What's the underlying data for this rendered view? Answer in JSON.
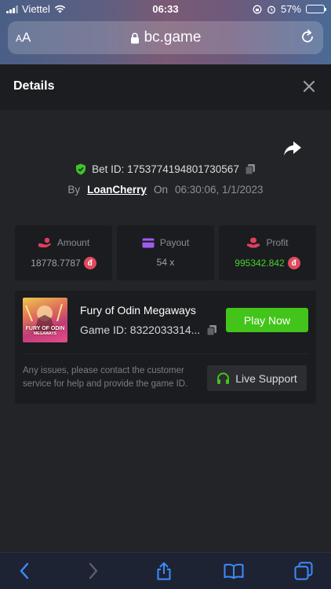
{
  "status_bar": {
    "carrier": "Viettel",
    "time": "06:33",
    "battery": "57%",
    "battery_level": 0.57
  },
  "browser": {
    "text_size_label": "AA",
    "url": "bc.game"
  },
  "modal": {
    "title": "Details"
  },
  "bet": {
    "id_label": "Bet ID: 1753774194801730567",
    "by_label": "By",
    "user": "LoanCherry",
    "on_label": "On",
    "datetime": "06:30:06, 1/1/2023"
  },
  "stats": [
    {
      "label": "Amount",
      "value": "18778.7787",
      "currency_icon": "d-coin-icon"
    },
    {
      "label": "Payout",
      "value": "54 x"
    },
    {
      "label": "Profit",
      "value": "995342.842",
      "currency_icon": "d-coin-icon"
    }
  ],
  "coin_symbol": "đ",
  "game": {
    "thumb_title": "FURY OF ODIN",
    "thumb_subtitle": "MEGAWAYS",
    "name": "Fury of Odin Megaways",
    "id_text": "Game ID: 8322033314...",
    "play_label": "Play Now",
    "help_text": "Any issues, please contact the customer service for help and provide the game ID.",
    "support_label": "Live Support"
  },
  "colors": {
    "accent_green": "#43c41a",
    "profit_green": "#4ad12c",
    "coin_red": "#e04a5e",
    "icon_pink": "#e0405e",
    "icon_purple": "#9d5cf0"
  }
}
